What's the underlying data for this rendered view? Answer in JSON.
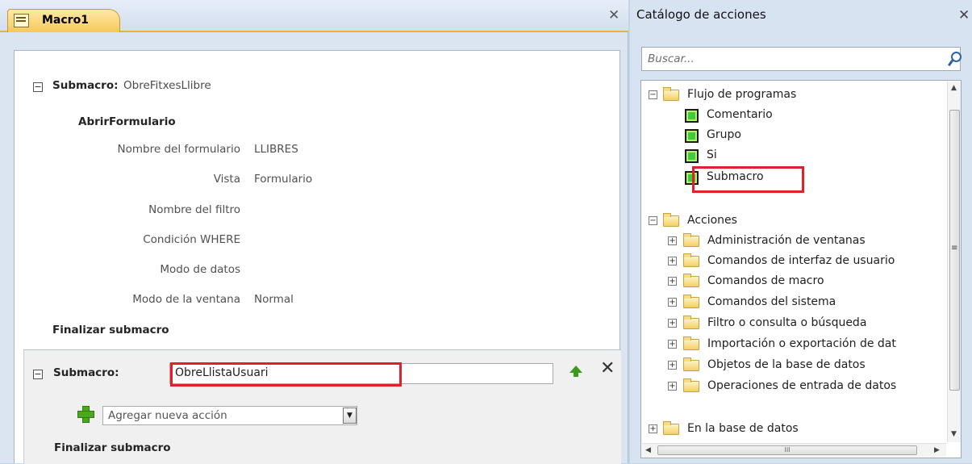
{
  "document_tab": {
    "title": "Macro1",
    "close_glyph": "✕"
  },
  "macro": {
    "submacro1": {
      "keyword": "Submacro:",
      "name": "ObreFitxesLlibre",
      "collapse_glyph": "⊟",
      "action": "AbrirFormulario",
      "args": [
        {
          "label": "Nombre del formulario",
          "value": "LLIBRES"
        },
        {
          "label": "Vista",
          "value": "Formulario"
        },
        {
          "label": "Nombre del filtro",
          "value": ""
        },
        {
          "label": "Condición WHERE",
          "value": ""
        },
        {
          "label": "Modo de datos",
          "value": ""
        },
        {
          "label": "Modo de la ventana",
          "value": "Normal"
        }
      ],
      "end_label": "Finalizar submacro"
    },
    "submacro2": {
      "keyword": "Submacro:",
      "name": "ObreLlistaUsuari",
      "add_action_placeholder": "Agregar nueva acción",
      "end_label": "Finalizar submacro",
      "delete_glyph": "✕"
    }
  },
  "catalog": {
    "title": "Catálogo de acciones",
    "close_glyph": "✕",
    "search_placeholder": "Buscar...",
    "groups": [
      {
        "label": "Flujo de programas",
        "expanded": true,
        "items": [
          "Comentario",
          "Grupo",
          "Si",
          "Submacro"
        ]
      },
      {
        "label": "Acciones",
        "expanded": true,
        "items": [
          "Administración de ventanas",
          "Comandos de interfaz de usuario",
          "Comandos de macro",
          "Comandos del sistema",
          "Filtro o consulta o búsqueda",
          "Importación o exportación de dat",
          "Objetos de la base de datos",
          "Operaciones de entrada de datos"
        ]
      },
      {
        "label": "En la base de datos",
        "expanded": false,
        "items": []
      }
    ],
    "highlighted_item": "Submacro",
    "scroll_grip": "≡",
    "hscroll_grip": "III"
  },
  "colors": {
    "highlight_border": "#e0202a",
    "tab_active": "#f6c85c",
    "pane_background": "#dbe5f1"
  }
}
